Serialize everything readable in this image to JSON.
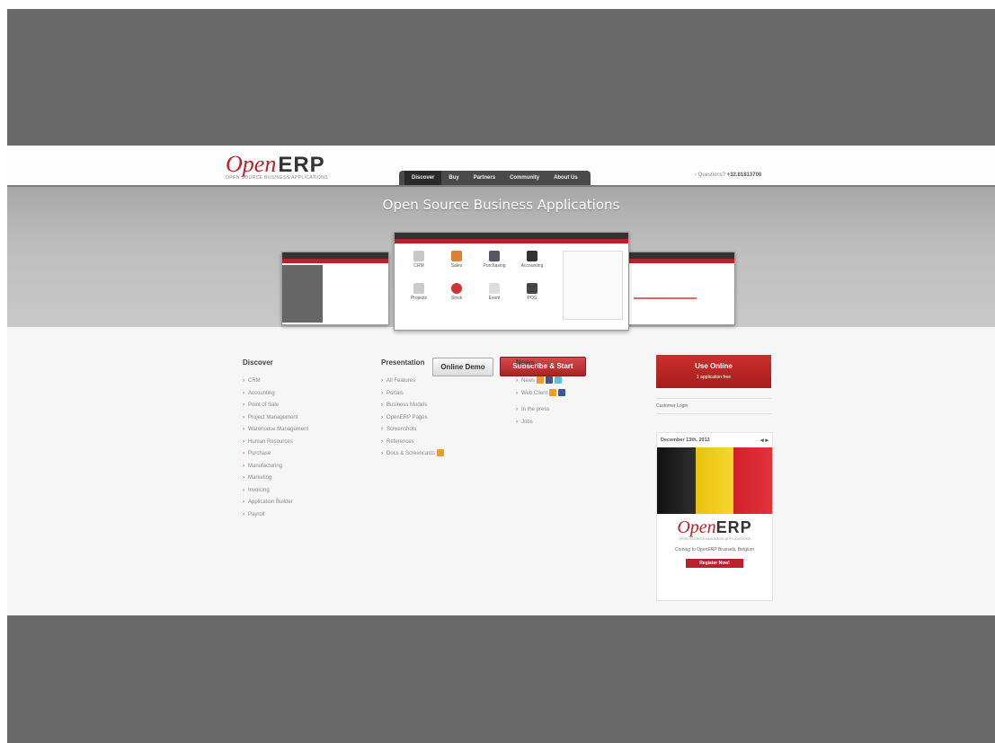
{
  "header": {
    "logo_open": "Open",
    "logo_erp": "ERP",
    "logo_tagline": "OPEN SOURCE BUSINESS APPLICATIONS",
    "nav": [
      "Discover",
      "Buy",
      "Partners",
      "Community",
      "About Us"
    ],
    "phone_label": "Questions?",
    "phone_number": "+32.81813700"
  },
  "hero": {
    "title": "Open Source Business Applications",
    "apps": [
      "CRM",
      "Sales",
      "Purchasing",
      "Accounting",
      "Projects",
      "Stock",
      "Event",
      "POS"
    ],
    "demo_button": "Online Demo",
    "subscribe_button": "Subscribe & Start"
  },
  "discover": {
    "title": "Discover",
    "items": [
      "CRM",
      "Accounting",
      "Point of Sale",
      "Project Management",
      "Warehouse Management",
      "Human Resources",
      "Purchase",
      "Manufacturing",
      "Marketing",
      "Invoicing",
      "Application Builder",
      "Payroll"
    ]
  },
  "presentation": {
    "title": "Presentation",
    "items": [
      "All Features",
      "Portals",
      "Business Models",
      "OpenERP Pages",
      "Screenshots",
      "References",
      "Docs & Screencasts"
    ]
  },
  "news": {
    "title": "News",
    "items": [
      "News",
      "Web Client",
      "In the press",
      "Jobs"
    ]
  },
  "sidebar": {
    "online_title": "Use Online",
    "online_subtitle": "1 application free",
    "login_label": "Customer Login",
    "event_date": "December 13th, 2012",
    "event_text": "Coming to OpenERP Brussels, Belgium",
    "register_label": "Register Now!",
    "flag_colors": [
      "#1b1b1b",
      "#f2cf1a",
      "#d8232f"
    ]
  }
}
